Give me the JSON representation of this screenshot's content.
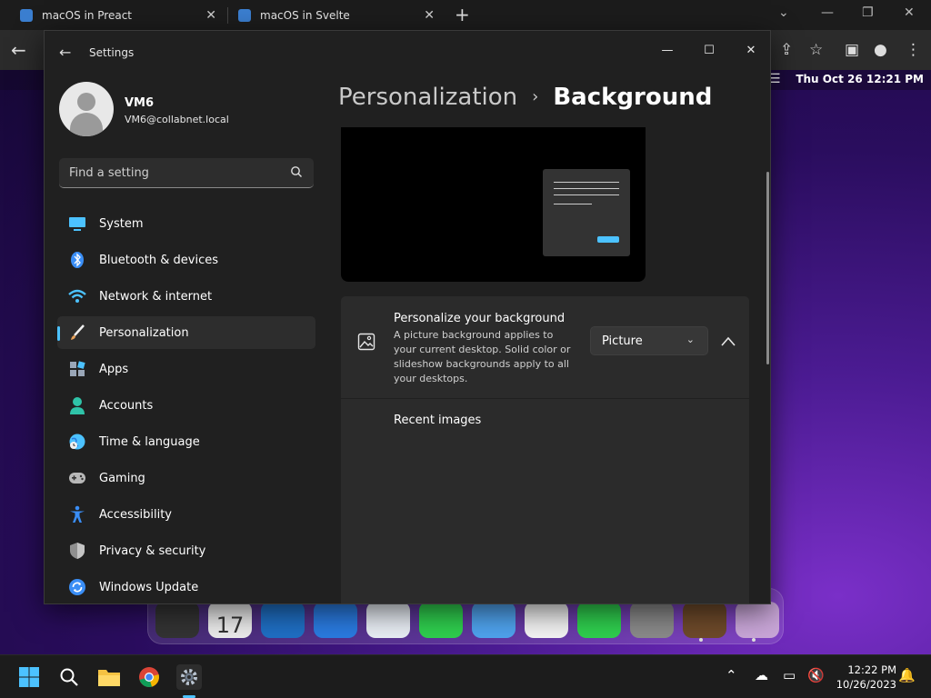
{
  "browser": {
    "tabs": [
      {
        "label": "macOS in Preact"
      },
      {
        "label": "macOS in Svelte"
      }
    ]
  },
  "mac": {
    "clock": "Thu Oct 26  12:21 PM",
    "dock_calendar_day": "17"
  },
  "settings": {
    "window_title": "Settings",
    "user": {
      "name": "VM6",
      "email": "VM6@collabnet.local"
    },
    "search_placeholder": "Find a setting",
    "nav": [
      {
        "label": "System",
        "icon": "monitor-icon",
        "color": "#4cc2ff"
      },
      {
        "label": "Bluetooth & devices",
        "icon": "bluetooth-icon",
        "color": "#3a8ef6"
      },
      {
        "label": "Network & internet",
        "icon": "wifi-icon",
        "color": "#4cc2ff"
      },
      {
        "label": "Personalization",
        "icon": "brush-icon",
        "color": "#e8a25a",
        "active": true
      },
      {
        "label": "Apps",
        "icon": "apps-icon",
        "color": "#9aa7b8"
      },
      {
        "label": "Accounts",
        "icon": "person-icon",
        "color": "#2fc3a8"
      },
      {
        "label": "Time & language",
        "icon": "globe-clock-icon",
        "color": "#4cc2ff"
      },
      {
        "label": "Gaming",
        "icon": "gamepad-icon",
        "color": "#b8b8b8"
      },
      {
        "label": "Accessibility",
        "icon": "accessibility-icon",
        "color": "#3a8ef6"
      },
      {
        "label": "Privacy & security",
        "icon": "shield-icon",
        "color": "#9a9a9a"
      },
      {
        "label": "Windows Update",
        "icon": "update-icon",
        "color": "#3a8ef6"
      }
    ],
    "breadcrumb": {
      "parent": "Personalization",
      "separator": "›",
      "current": "Background"
    },
    "personalize": {
      "title": "Personalize your background",
      "description": "A picture background applies to your current desktop. Solid color or slideshow backgrounds apply to all your desktops.",
      "selected": "Picture"
    },
    "recent_images_label": "Recent images"
  },
  "taskbar": {
    "time": "12:22 PM",
    "date": "10/26/2023"
  },
  "colors": {
    "accent": "#4cc2ff",
    "window_bg": "#202020",
    "card_bg": "#2b2b2b"
  }
}
